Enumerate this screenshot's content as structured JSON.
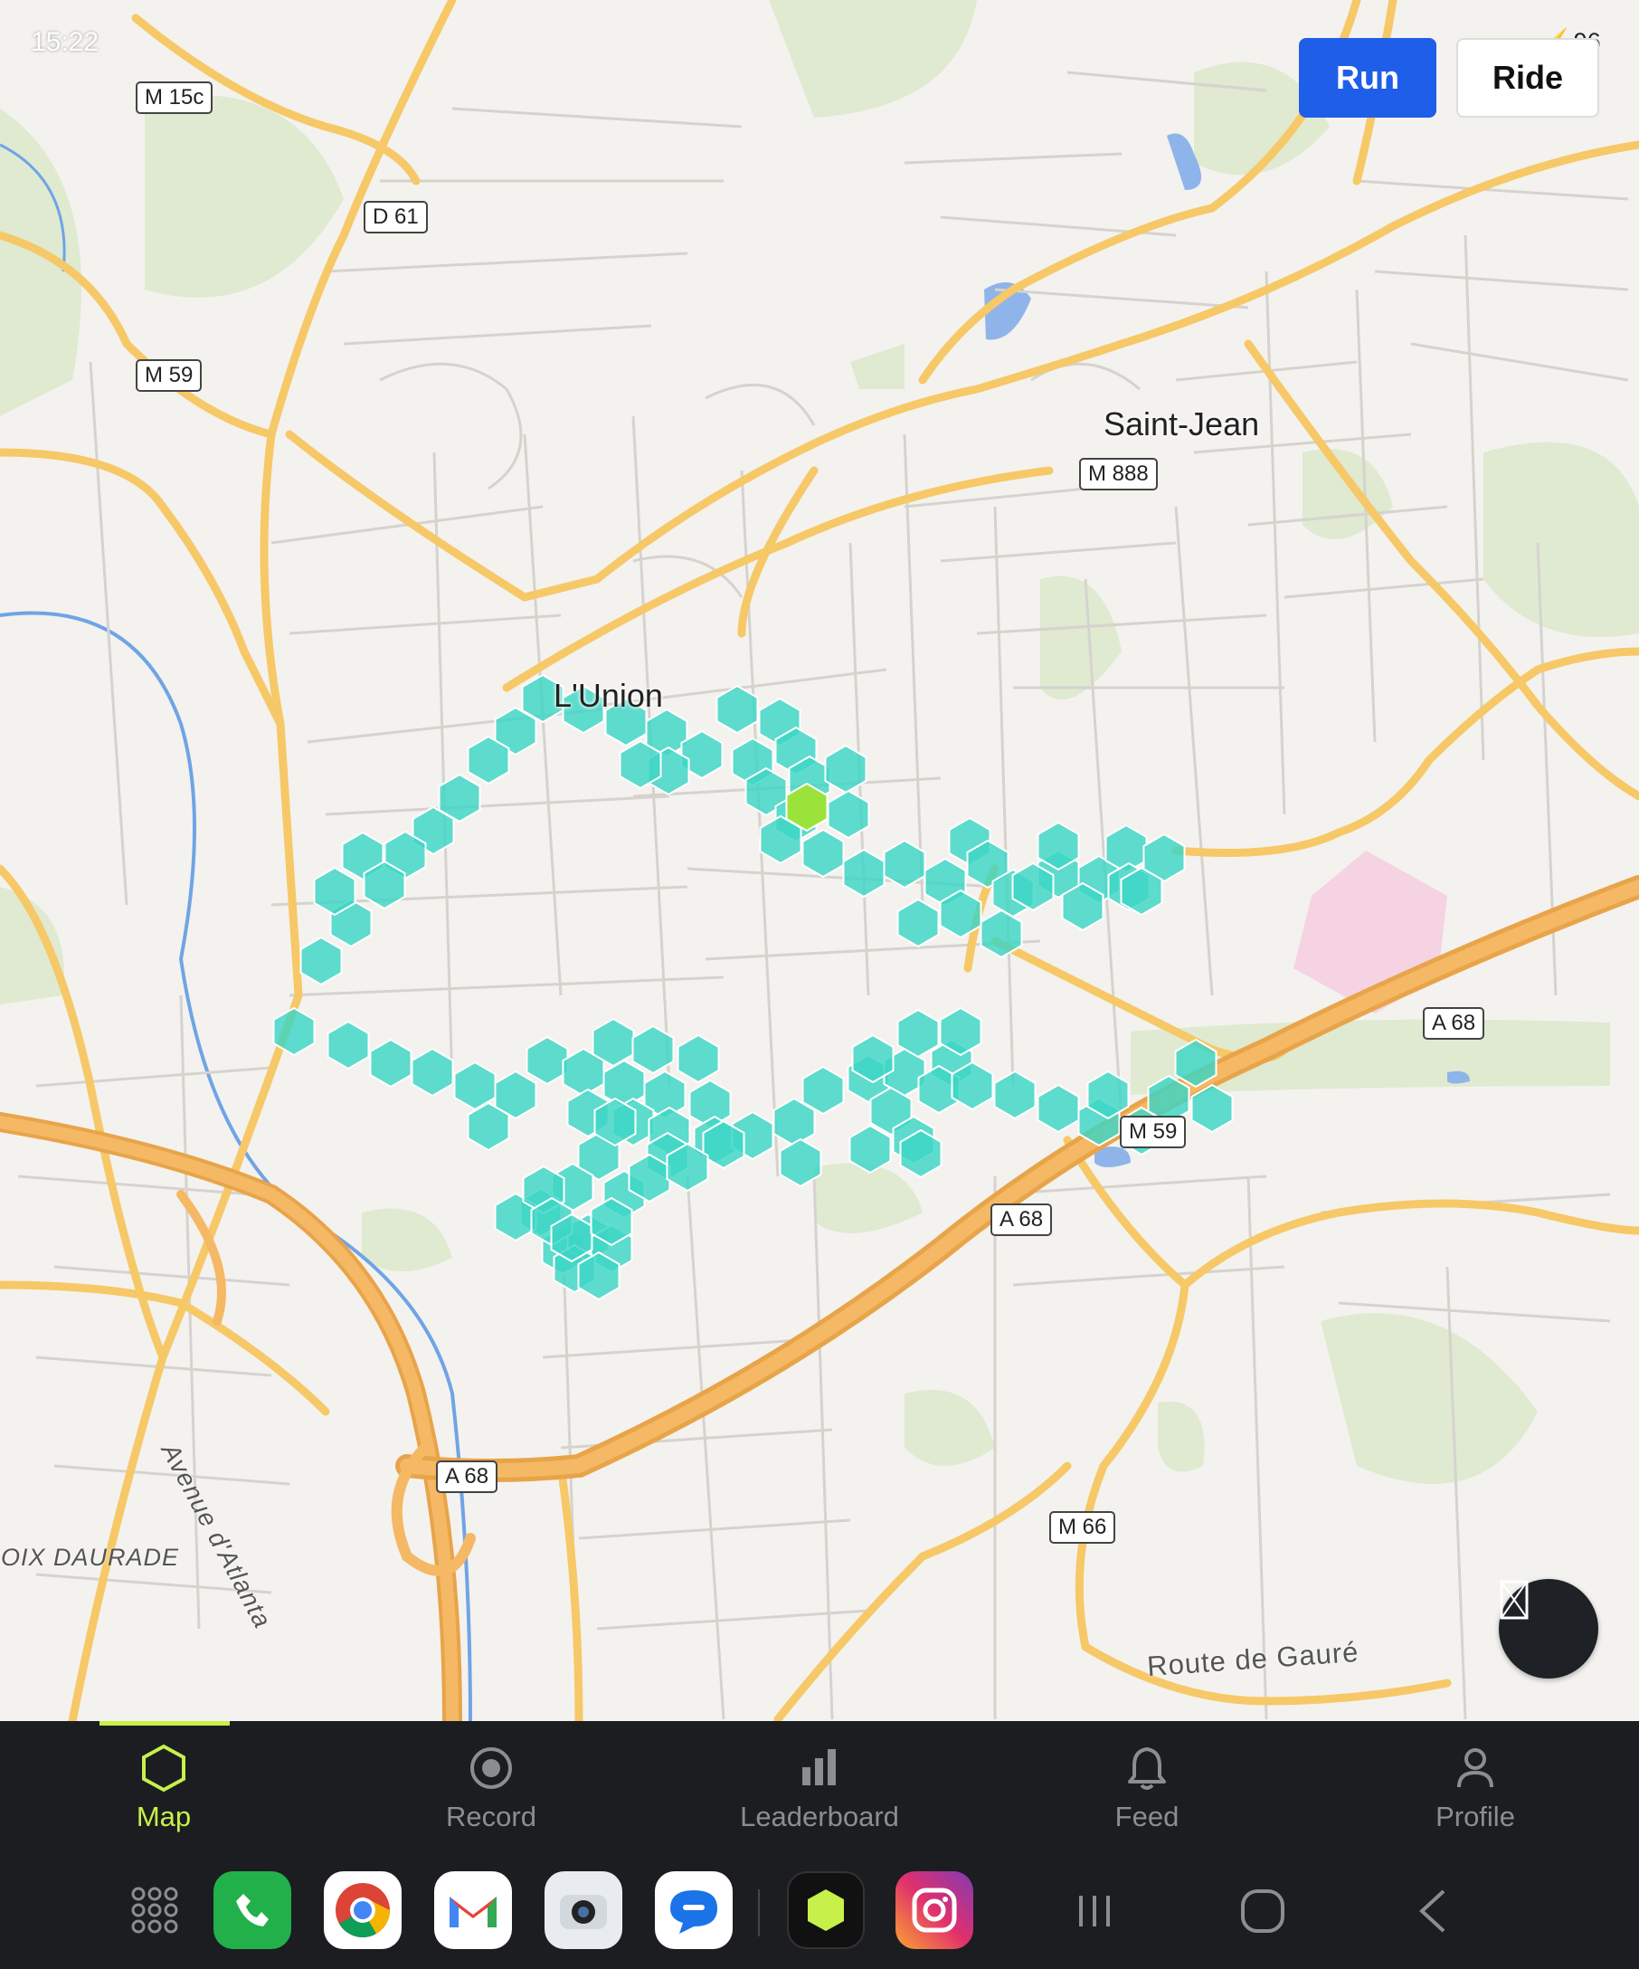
{
  "status_bar": {
    "time": "15:22",
    "battery": "96"
  },
  "mode_toggle": {
    "run_label": "Run",
    "ride_label": "Ride"
  },
  "map": {
    "places": [
      "Saint-Jean",
      "L'Union",
      "CROIX DAURADE"
    ],
    "road_shields": [
      "M 15c",
      "D 61",
      "M 59",
      "M 888",
      "A 68",
      "A 68",
      "A 68",
      "M 59",
      "M 66"
    ],
    "streets": [
      "Avenue d'Atlanta",
      "Route de Gauré"
    ],
    "colors": {
      "hex_fill": "#3cd6c4",
      "hex_current": "#9be23a",
      "road_major": "#f6c867",
      "motorway": "#f1a94e",
      "water": "#6fa4e6",
      "park": "#dfead1"
    }
  },
  "fab": {
    "icon": "layers-icon"
  },
  "bottom_nav": {
    "items": [
      {
        "label": "Map",
        "icon": "hexagon-icon",
        "active": true
      },
      {
        "label": "Record",
        "icon": "record-icon"
      },
      {
        "label": "Leaderboard",
        "icon": "bar-chart-icon"
      },
      {
        "label": "Feed",
        "icon": "bell-icon"
      },
      {
        "label": "Profile",
        "icon": "person-icon"
      }
    ]
  },
  "dock": {
    "apps": [
      "apps-grid-icon",
      "phone-icon",
      "chrome-icon",
      "gmail-icon",
      "camera-icon",
      "messages-icon",
      "hex-app-icon",
      "instagram-icon"
    ],
    "system": [
      "recents-icon",
      "home-icon",
      "back-icon"
    ]
  }
}
